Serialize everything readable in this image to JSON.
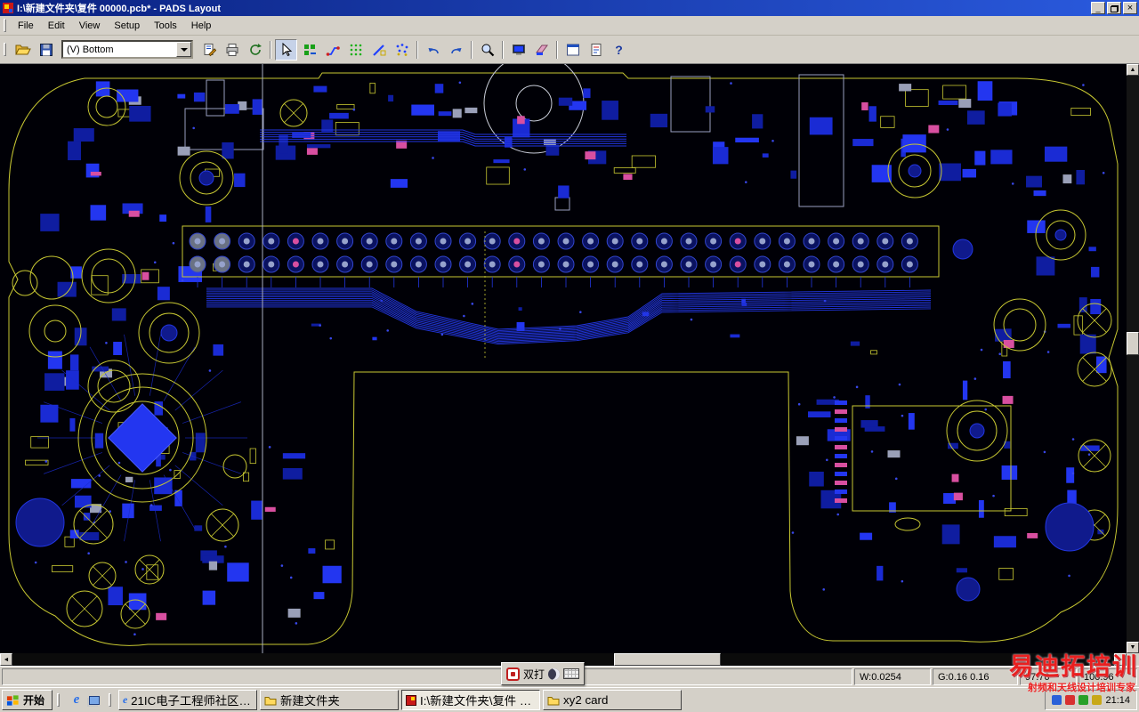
{
  "window": {
    "title": "I:\\新建文件夹\\复件 00000.pcb* - PADS Layout",
    "minimize_glyph": "_",
    "close_glyph": "×"
  },
  "menu": {
    "items": [
      {
        "label": "File"
      },
      {
        "label": "Edit"
      },
      {
        "label": "View"
      },
      {
        "label": "Setup"
      },
      {
        "label": "Tools"
      },
      {
        "label": "Help"
      }
    ]
  },
  "toolbar": {
    "layer_value": "(V) Bottom",
    "help_glyph": "?",
    "icons": [
      "open-icon",
      "save-icon",
      "layer-dropdown",
      "eco-icon",
      "print-icon",
      "redraw-icon",
      "select-arrow-icon",
      "design-toolbar-icon",
      "router-toolbar-icon",
      "grid-icon",
      "drafting-toolbar-icon",
      "dimension-toolbar-icon",
      "undo-icon",
      "redo-icon",
      "zoom-icon",
      "board-monitor-icon",
      "pour-icon",
      "window-icon",
      "report-icon",
      "help-icon"
    ]
  },
  "scrollbars": {
    "up": "▲",
    "down": "▼",
    "left": "◄",
    "right": "►"
  },
  "statusbar": {
    "width": "W:0.0254",
    "grid": "G:0.16 0.16",
    "x": "97.76",
    "y": "100.96"
  },
  "ime": {
    "label": "双打"
  },
  "taskbar": {
    "start_label": "开始",
    "quicklaunch": [
      {
        "name": "ie-icon",
        "glyph": "e"
      },
      {
        "name": "desktop-icon"
      }
    ],
    "tasks": [
      {
        "label": "21IC电子工程师社区 - ...",
        "active": false
      },
      {
        "label": "新建文件夹",
        "active": false
      },
      {
        "label": "I:\\新建文件夹\\复件 00...",
        "active": true
      },
      {
        "label": "xy2 card",
        "active": false
      }
    ],
    "tray_icons": [
      "tray-icon-1",
      "tray-icon-2",
      "tray-icon-3",
      "tray-icon-4"
    ],
    "clock": "21:14"
  },
  "watermark": {
    "line1": "易迪拓培训",
    "line2": "射频和天线设计培训专家"
  },
  "pcb": {
    "background": "#000006",
    "trace_color": "#2236e0",
    "outline_color": "#c8c832",
    "pad_pink": "#d84fa0",
    "component_blue": "#2336f0"
  }
}
